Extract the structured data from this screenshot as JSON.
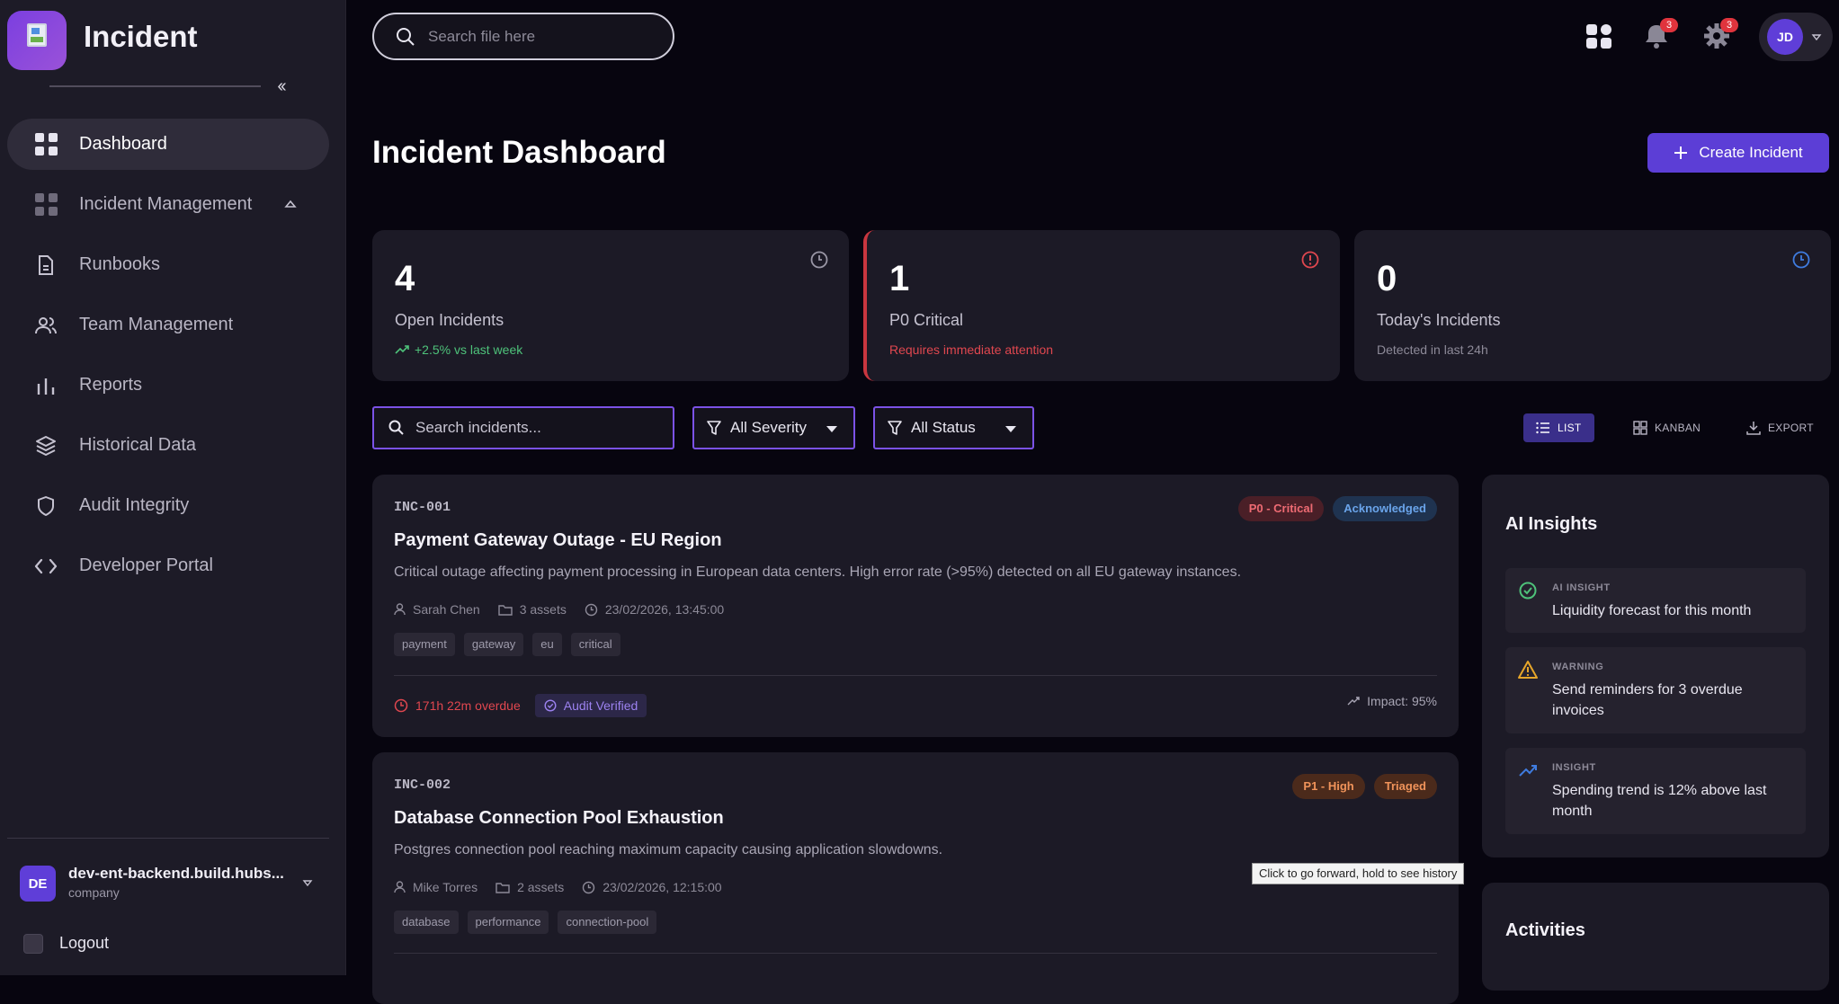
{
  "app": {
    "title": "Incident"
  },
  "sidebar": {
    "items": [
      {
        "label": "Dashboard",
        "icon": "dashboard-icon"
      },
      {
        "label": "Incident Management",
        "icon": "incident-management-icon"
      },
      {
        "label": "Runbooks",
        "icon": "file-icon"
      },
      {
        "label": "Team Management",
        "icon": "users-icon"
      },
      {
        "label": "Reports",
        "icon": "bar-chart-icon"
      },
      {
        "label": "Historical Data",
        "icon": "layers-icon"
      },
      {
        "label": "Audit Integrity",
        "icon": "shield-icon"
      },
      {
        "label": "Developer Portal",
        "icon": "code-icon"
      }
    ],
    "account": {
      "initials": "DE",
      "name": "dev-ent-backend.build.hubs...",
      "type": "company"
    },
    "logout_label": "Logout"
  },
  "topbar": {
    "search_placeholder": "Search file here",
    "notifications_count": "3",
    "settings_count": "3",
    "user_initials": "JD"
  },
  "page": {
    "title": "Incident Dashboard",
    "create_label": "Create Incident"
  },
  "stats": [
    {
      "value": "4",
      "label": "Open Incidents",
      "sub": "+2.5% vs last week",
      "sub_color": "#4ec27a"
    },
    {
      "value": "1",
      "label": "P0 Critical",
      "sub": "Requires immediate attention",
      "sub_color": "#e0474f"
    },
    {
      "value": "0",
      "label": "Today's Incidents",
      "sub": "Detected in last 24h",
      "sub_color": "#8d8a98"
    }
  ],
  "filters": {
    "search_placeholder": "Search incidents...",
    "severity": "All Severity",
    "status": "All Status",
    "views": {
      "list": "LIST",
      "kanban": "KANBAN",
      "export": "EXPORT"
    }
  },
  "incidents": [
    {
      "id": "INC-001",
      "title": "Payment Gateway Outage - EU Region",
      "description": "Critical outage affecting payment processing in European data centers. High error rate (>95%) detected on all EU gateway instances.",
      "assignee": "Sarah Chen",
      "assets": "3 assets",
      "datetime": "23/02/2026, 13:45:00",
      "tags": [
        "payment",
        "gateway",
        "eu",
        "critical"
      ],
      "severity": "P0 - Critical",
      "status": "Acknowledged",
      "overdue": "171h 22m overdue",
      "audit": "Audit Verified",
      "impact": "Impact: 95%"
    },
    {
      "id": "INC-002",
      "title": "Database Connection Pool Exhaustion",
      "description": "Postgres connection pool reaching maximum capacity causing application slowdowns.",
      "assignee": "Mike Torres",
      "assets": "2 assets",
      "datetime": "23/02/2026, 12:15:00",
      "tags": [
        "database",
        "performance",
        "connection-pool"
      ],
      "severity": "P1 - High",
      "status": "Triaged"
    }
  ],
  "insights": {
    "title": "AI Insights",
    "items": [
      {
        "kind": "AI INSIGHT",
        "text": "Liquidity forecast for this month",
        "icon": "check-circle-icon"
      },
      {
        "kind": "WARNING",
        "text": "Send reminders for 3 overdue invoices",
        "icon": "warning-icon"
      },
      {
        "kind": "INSIGHT",
        "text": "Spending trend is 12% above last month",
        "icon": "trend-up-icon"
      }
    ]
  },
  "activities": {
    "title": "Activities"
  },
  "tooltip": "Click to go forward, hold to see history",
  "colors": {
    "accent": "#5c3ed6",
    "danger": "#e0474f",
    "success": "#4ec27a"
  }
}
